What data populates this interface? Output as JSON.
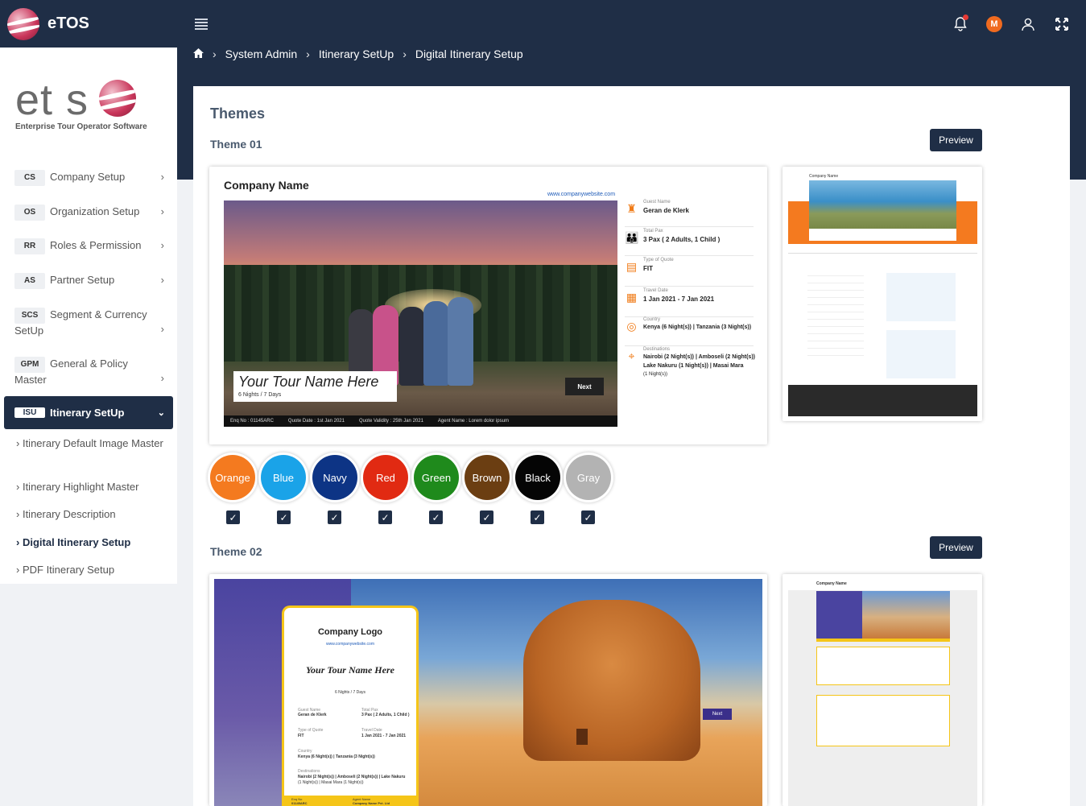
{
  "app": {
    "name": "eTOS",
    "logo_word": "et s",
    "logo_tagline": "Enterprise Tour Operator Software",
    "avatar_initial": "M"
  },
  "breadcrumb": [
    "System Admin",
    "Itinerary SetUp",
    "Digital Itinerary Setup"
  ],
  "sidebar": {
    "items": [
      {
        "code": "CS",
        "label": "Company Setup"
      },
      {
        "code": "OS",
        "label": "Organization Setup"
      },
      {
        "code": "RR",
        "label": "Roles & Permission"
      },
      {
        "code": "AS",
        "label": "Partner Setup"
      },
      {
        "code": "SCS",
        "label": "Segment & Currency SetUp"
      },
      {
        "code": "GPM",
        "label": "General & Policy Master"
      }
    ],
    "active": {
      "code": "ISU",
      "label": "Itinerary SetUp"
    },
    "subitems": [
      "Itinerary Default Image Master",
      "Itinerary Highlight Master",
      "Itinerary Description",
      "Digital Itinerary Setup",
      "PDF Itinerary Setup"
    ]
  },
  "main": {
    "title": "Themes",
    "theme1_label": "Theme 01",
    "theme2_label": "Theme 02",
    "preview_label": "Preview",
    "theme1": {
      "company": "Company Name",
      "website": "www.companywebsite.com",
      "tour_name": "Your Tour Name Here",
      "nights": "6 Nights / 7 Days",
      "next": "Next",
      "footer": [
        "Enq No : 01145ARC",
        "Quote Date : 1st Jan 2021",
        "Quote Validity : 25th Jan 2021",
        "Agent Name : Lorem dolor ipsum"
      ],
      "info": [
        {
          "label": "Guest Name",
          "value": "Geran de Klerk"
        },
        {
          "label": "Total Pax",
          "value": "3 Pax ( 2 Adults, 1 Child )"
        },
        {
          "label": "Type of Quote",
          "value": "FIT"
        },
        {
          "label": "Travel Date",
          "value": "1 Jan 2021  -  7 Jan 2021"
        },
        {
          "label": "Country",
          "value": "Kenya (6 Night(s))  |  Tanzania (3 Night(s))"
        },
        {
          "label": "Destinations",
          "value": "Nairobi (2 Night(s))  |  Amboseli (2 Night(s))",
          "value2": "Lake Nakuru (1 Night(s))  |  Masai Mara",
          "value3": "(1 Night(s))"
        }
      ]
    },
    "colors": [
      {
        "name": "Orange",
        "hex": "#f47a1f"
      },
      {
        "name": "Blue",
        "hex": "#1aa3e8"
      },
      {
        "name": "Navy",
        "hex": "#0d3485"
      },
      {
        "name": "Red",
        "hex": "#e12a12"
      },
      {
        "name": "Green",
        "hex": "#1f8a1c"
      },
      {
        "name": "Brown",
        "hex": "#6b3e12"
      },
      {
        "name": "Black",
        "hex": "#050505"
      },
      {
        "name": "Gray",
        "hex": "#b3b3b3"
      }
    ],
    "theme2": {
      "logo": "Company Logo",
      "website": "www.companywebsite.com",
      "tour_name": "Your Tour Name Here",
      "nights": "6 Nights / 7 Days",
      "next": "Next",
      "guest_label": "Guest Name",
      "guest": "Geran de Klerk",
      "pax_label": "Total Pax",
      "pax": "3 Pax ( 2 Adults, 1 Child )",
      "quote_label": "Type of Quote",
      "quote": "FIT",
      "date_label": "Travel Date",
      "date": "1 Jan 2021  -  7 Jan 2021",
      "country_label": "Country",
      "country": "Kenya (6 Night(s))  |  Tanzania (3 Night(s))",
      "dest_label": "Destinations",
      "dest": "Nairobi (2 Night(s))  |  Amboseli (2 Night(s))  |  Lake Nakuru",
      "dest2": "(1 Night(s))  |  Masai Mara (1 Night(s))",
      "enq": "Enq No",
      "agent": "Agent Name",
      "enq_val": "01145ARC",
      "agent_val": "Company Name Pvt. Ltd",
      "thumb_company": "Company Name"
    }
  }
}
